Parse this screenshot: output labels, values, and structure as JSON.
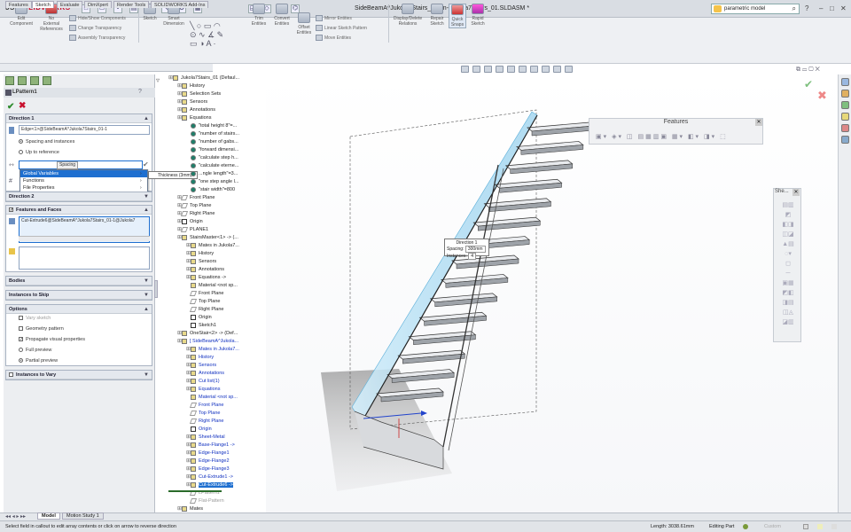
{
  "app": {
    "logo_brand": "3S",
    "logo_name": "SOLIDWORKS",
    "document_title": "SideBeamA^Jukola7Stairs_01 -in- Jukola7Stairs_01.SLDASM *",
    "search_placeholder": "parametric model"
  },
  "ribbon": {
    "edit_component": "Edit\nComponent",
    "no_external_refs": "No\nExternal\nReferences",
    "hide_show": "Hide/Show Components",
    "change_transparency": "Change Transparency",
    "assembly_transparency": "Assembly Transparency",
    "sketch": "Sketch",
    "smart_dimension": "Smart\nDimension",
    "trim_entities": "Trim\nEntities",
    "convert_entities": "Convert\nEntities",
    "offset_entities": "Offset\nEntities",
    "mirror_entities": "Mirror Entities",
    "linear_sketch_pattern": "Linear Sketch Pattern",
    "move_entities": "Move Entities",
    "display_delete_relations": "Display/Delete\nRelations",
    "repair_sketch": "Repair\nSketch",
    "quick_snaps": "Quick\nSnaps",
    "rapid_sketch": "Rapid\nSketch"
  },
  "tabs": [
    "Features",
    "Sketch",
    "Evaluate",
    "DimXpert",
    "Render Tools",
    "SOLIDWORKS Add-Ins"
  ],
  "active_tab": "Sketch",
  "property_manager": {
    "title": "LPattern1",
    "direction1": {
      "header": "Direction 1",
      "edge_field": "Edge<1>@SideBeamA^Jukola7Stairs_01-1",
      "option_spacing": "Spacing and instances",
      "option_up_to": "Up to reference",
      "spacing_value": "Spacing",
      "popup_items": [
        "Global Variables",
        "Functions",
        "File Properties"
      ],
      "tooltip": "Thickness (3mm)"
    },
    "direction2": {
      "header": "Direction 2"
    },
    "features_faces": {
      "header": "Features and Faces",
      "item": "Cut-Extrude6@SideBeamA^Jukola7Stairs_01-1@Jukola7"
    },
    "bodies": {
      "header": "Bodies"
    },
    "instances_skip": {
      "header": "Instances to Skip"
    },
    "options": {
      "header": "Options",
      "vary_sketch": "Vary sketch",
      "geometry_pattern": "Geometry pattern",
      "propagate": "Propagate visual properties",
      "full_preview": "Full preview",
      "partial_preview": "Partial preview"
    },
    "instances_vary": {
      "header": "Instances to Vary"
    }
  },
  "tree": [
    {
      "label": "Jukola7Stairs_01 (Defaul...",
      "indent": 0,
      "icon": "assembly",
      "style": ""
    },
    {
      "label": "History",
      "indent": 1,
      "icon": "folder",
      "style": ""
    },
    {
      "label": "Selection Sets",
      "indent": 1,
      "icon": "folder",
      "style": ""
    },
    {
      "label": "Sensors",
      "indent": 1,
      "icon": "folder",
      "style": ""
    },
    {
      "label": "Annotations",
      "indent": 1,
      "icon": "folder",
      "style": ""
    },
    {
      "label": "Equations",
      "indent": 1,
      "icon": "folder",
      "style": ""
    },
    {
      "label": "\"total height 8\"=...",
      "indent": 2,
      "icon": "eq",
      "style": ""
    },
    {
      "label": "\"number of stairs...",
      "indent": 2,
      "icon": "eq",
      "style": ""
    },
    {
      "label": "\"number of gabs...",
      "indent": 2,
      "icon": "eq",
      "style": ""
    },
    {
      "label": "\"forward dimensi...",
      "indent": 2,
      "icon": "eq",
      "style": ""
    },
    {
      "label": "\"calculate step h...",
      "indent": 2,
      "icon": "eq",
      "style": ""
    },
    {
      "label": "\"calculate eterne...",
      "indent": 2,
      "icon": "eq",
      "style": ""
    },
    {
      "label": "...ngle length\"=3...",
      "indent": 2,
      "icon": "eq",
      "style": ""
    },
    {
      "label": "\"one step angle l...",
      "indent": 2,
      "icon": "eq",
      "style": ""
    },
    {
      "label": "\"stair width\"=800",
      "indent": 2,
      "icon": "eq",
      "style": ""
    },
    {
      "label": "Front Plane",
      "indent": 1,
      "icon": "plane",
      "style": ""
    },
    {
      "label": "Top Plane",
      "indent": 1,
      "icon": "plane",
      "style": ""
    },
    {
      "label": "Right Plane",
      "indent": 1,
      "icon": "plane",
      "style": ""
    },
    {
      "label": "Origin",
      "indent": 1,
      "icon": "origin",
      "style": ""
    },
    {
      "label": "PLANE1",
      "indent": 1,
      "icon": "plane",
      "style": ""
    },
    {
      "label": "StairsMaster<1> -> (...",
      "indent": 1,
      "icon": "part",
      "style": ""
    },
    {
      "label": "Mates in Jukola7...",
      "indent": 2,
      "icon": "folder",
      "style": ""
    },
    {
      "label": "History",
      "indent": 2,
      "icon": "folder",
      "style": ""
    },
    {
      "label": "Sensors",
      "indent": 2,
      "icon": "folder",
      "style": ""
    },
    {
      "label": "Annotations",
      "indent": 2,
      "icon": "folder",
      "style": ""
    },
    {
      "label": "Equations ->",
      "indent": 2,
      "icon": "folder",
      "style": ""
    },
    {
      "label": "Material <not sp...",
      "indent": 2,
      "icon": "material",
      "style": ""
    },
    {
      "label": "Front Plane",
      "indent": 2,
      "icon": "plane",
      "style": ""
    },
    {
      "label": "Top Plane",
      "indent": 2,
      "icon": "plane",
      "style": ""
    },
    {
      "label": "Right Plane",
      "indent": 2,
      "icon": "plane",
      "style": ""
    },
    {
      "label": "Origin",
      "indent": 2,
      "icon": "origin",
      "style": ""
    },
    {
      "label": "Sketch1",
      "indent": 2,
      "icon": "sketch",
      "style": ""
    },
    {
      "label": "OneStair<2> -> (Def...",
      "indent": 1,
      "icon": "part",
      "style": ""
    },
    {
      "label": "[ SideBeamA^Jukola...",
      "indent": 1,
      "icon": "part",
      "style": "blue"
    },
    {
      "label": "Mates in Jukola7...",
      "indent": 2,
      "icon": "folder",
      "style": "blue"
    },
    {
      "label": "History",
      "indent": 2,
      "icon": "folder",
      "style": "blue"
    },
    {
      "label": "Sensors",
      "indent": 2,
      "icon": "folder",
      "style": "blue"
    },
    {
      "label": "Annotations",
      "indent": 2,
      "icon": "folder",
      "style": "blue"
    },
    {
      "label": "Cut list(1)",
      "indent": 2,
      "icon": "folder",
      "style": "blue"
    },
    {
      "label": "Equations",
      "indent": 2,
      "icon": "folder",
      "style": "blue"
    },
    {
      "label": "Material <not sp...",
      "indent": 2,
      "icon": "material",
      "style": "blue"
    },
    {
      "label": "Front Plane",
      "indent": 2,
      "icon": "plane",
      "style": "blue"
    },
    {
      "label": "Top Plane",
      "indent": 2,
      "icon": "plane",
      "style": "blue"
    },
    {
      "label": "Right Plane",
      "indent": 2,
      "icon": "plane",
      "style": "blue"
    },
    {
      "label": "Origin",
      "indent": 2,
      "icon": "origin",
      "style": "blue"
    },
    {
      "label": "Sheet-Metal",
      "indent": 2,
      "icon": "folder",
      "style": "blue"
    },
    {
      "label": "Base-Flange1 ->",
      "indent": 2,
      "icon": "folder",
      "style": "blue"
    },
    {
      "label": "Edge-Flange1",
      "indent": 2,
      "icon": "folder",
      "style": "blue"
    },
    {
      "label": "Edge-Flange2",
      "indent": 2,
      "icon": "folder",
      "style": "blue"
    },
    {
      "label": "Edge-Flange3",
      "indent": 2,
      "icon": "folder",
      "style": "blue"
    },
    {
      "label": "Cut-Extrude1 ->",
      "indent": 2,
      "icon": "folder",
      "style": "blue"
    },
    {
      "label": "Cut-Extrude6 ->",
      "indent": 2,
      "icon": "folder",
      "style": "hl"
    },
    {
      "label": "LPattern1",
      "indent": 2,
      "icon": "pattern",
      "style": "faded"
    },
    {
      "label": "Flat-Pattern",
      "indent": 2,
      "icon": "pattern",
      "style": "faded"
    },
    {
      "label": "Mates",
      "indent": 1,
      "icon": "folder",
      "style": ""
    }
  ],
  "viewport": {
    "features_panel_title": "Features",
    "she_panel_title": "She...",
    "callout_title": "Direction 1",
    "callout_spacing_label": "Spacing:",
    "callout_spacing_value": "300mm",
    "callout_instances_label": "Instances:",
    "callout_instances_value": "4"
  },
  "bottom_tabs": [
    "Model",
    "Motion Study 1"
  ],
  "status": {
    "message": "Select field in callout to edit array contents or click on arrow to reverse direction",
    "length": "Length: 3038.61mm",
    "mode": "Editing Part",
    "custom": "Custom"
  },
  "colors": {
    "accent": "#1e6fd0",
    "brand": "#c8102e",
    "glass": "#a8d8f0"
  }
}
